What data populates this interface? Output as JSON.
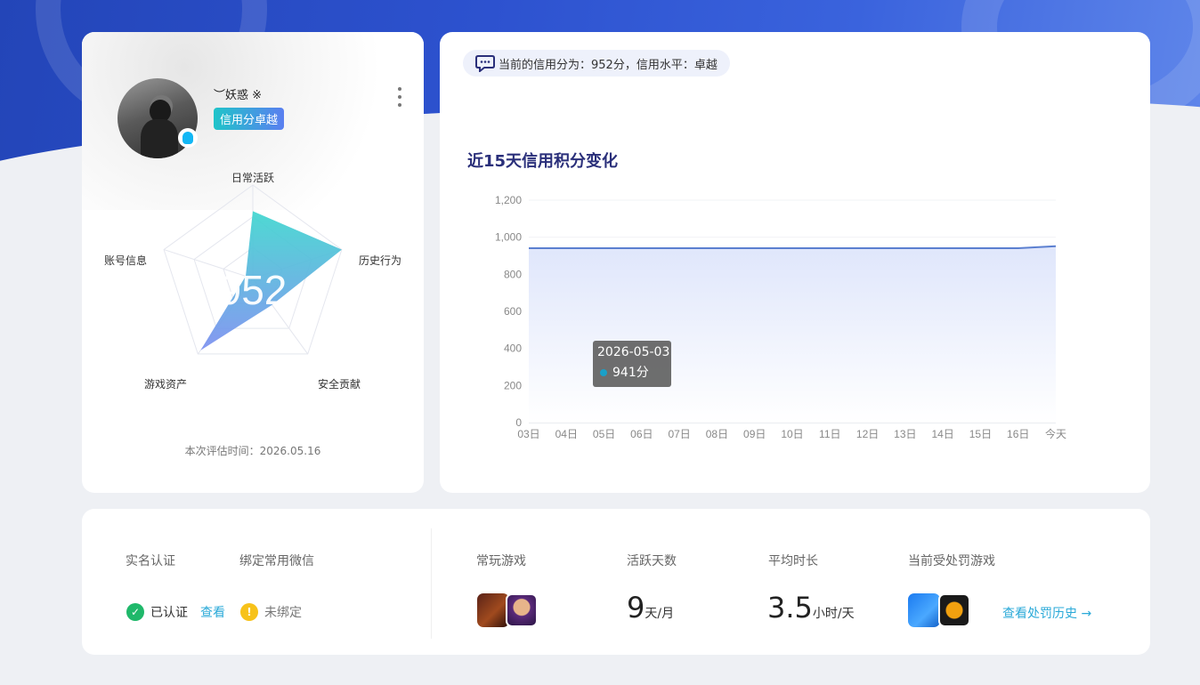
{
  "profile": {
    "nickname": "︶妖惑 ※",
    "level_tag": "信用分卓越",
    "score": "952",
    "eval_time": "本次评估时间：2026.05.16",
    "radar_labels": [
      "日常活跃",
      "历史行为",
      "安全贡献",
      "游戏资产",
      "账号信息"
    ]
  },
  "credit": {
    "message": "当前的信用分为：952分，信用水平：卓越"
  },
  "chart": {
    "title": "近15天信用积分变化",
    "tooltip_date": "2026-05-03",
    "tooltip_value": "941分"
  },
  "chart_data": {
    "type": "area",
    "categories": [
      "03日",
      "04日",
      "05日",
      "06日",
      "07日",
      "08日",
      "09日",
      "10日",
      "11日",
      "12日",
      "13日",
      "14日",
      "15日",
      "16日",
      "今天"
    ],
    "values": [
      941,
      941,
      941,
      941,
      941,
      941,
      941,
      941,
      941,
      941,
      941,
      941,
      941,
      941,
      952
    ],
    "yticks": [
      "0",
      "200",
      "400",
      "600",
      "800",
      "1,000",
      "1,200"
    ],
    "ylim": [
      0,
      1200
    ],
    "color": "#5b7fd0",
    "fill": "#e1e7fb"
  },
  "radar_data": {
    "axes": [
      "日常活跃",
      "历史行为",
      "安全贡献",
      "游戏资产",
      "账号信息"
    ],
    "values": [
      0.72,
      1.0,
      0.35,
      0.95,
      0.08
    ]
  },
  "stats": {
    "real_name_label": "实名认证",
    "wechat_label": "绑定常用微信",
    "real_name_status": "已认证",
    "view_link": "查看",
    "wechat_status": "未绑定",
    "games_label": "常玩游戏",
    "active_days_label": "活跃天数",
    "active_days_value": "9",
    "active_days_unit": "天/月",
    "avg_time_label": "平均时长",
    "avg_time_value": "3.5",
    "avg_time_unit": "小时/天",
    "punished_label": "当前受处罚游戏",
    "history_link": "查看处罚历史 →"
  }
}
